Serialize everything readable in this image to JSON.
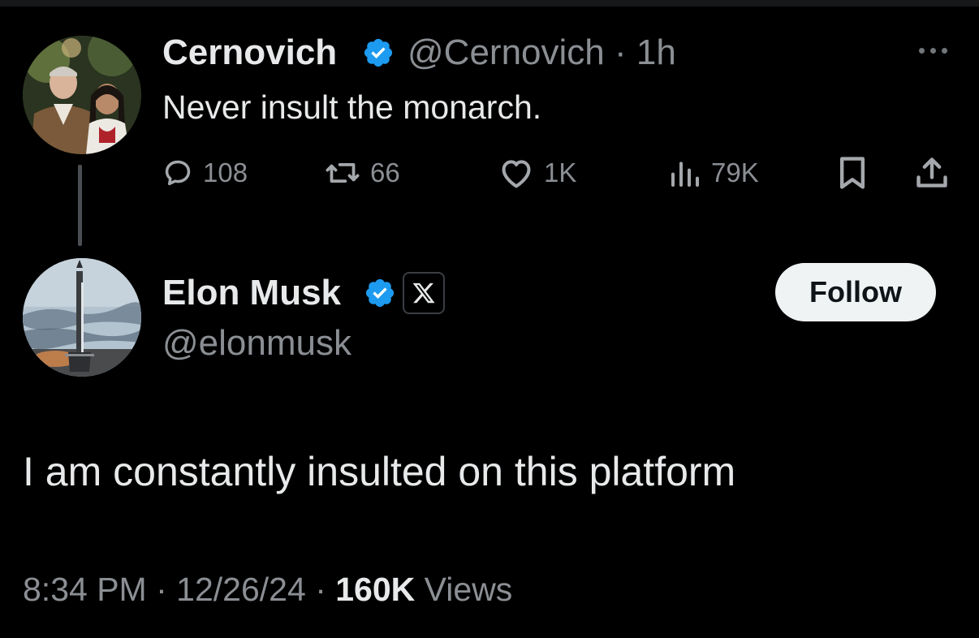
{
  "parent_tweet": {
    "author_name": "Cernovich",
    "handle": "@Cernovich",
    "separator": "·",
    "time_ago": "1h",
    "text": "Never insult the monarch.",
    "actions": {
      "replies": "108",
      "reposts": "66",
      "likes": "1K",
      "views": "79K"
    },
    "avatar_icon": "profile-photo",
    "more_icon": "more-horizontal-icon"
  },
  "main_tweet": {
    "author_name": "Elon Musk",
    "handle": "@elonmusk",
    "affiliate_badge": "X",
    "follow_label": "Follow",
    "text": "I am constantly insulted on this platform",
    "time": "8:34 PM",
    "date": "12/26/24",
    "separator": "·",
    "views_count": "160K",
    "views_label": "Views",
    "avatar_icon": "profile-photo-rocket"
  },
  "colors": {
    "background": "#000000",
    "primary_text": "#e7e9ea",
    "secondary_text": "#8b8f94",
    "verified_blue": "#1d9bf0",
    "follow_bg": "#eff3f4"
  }
}
